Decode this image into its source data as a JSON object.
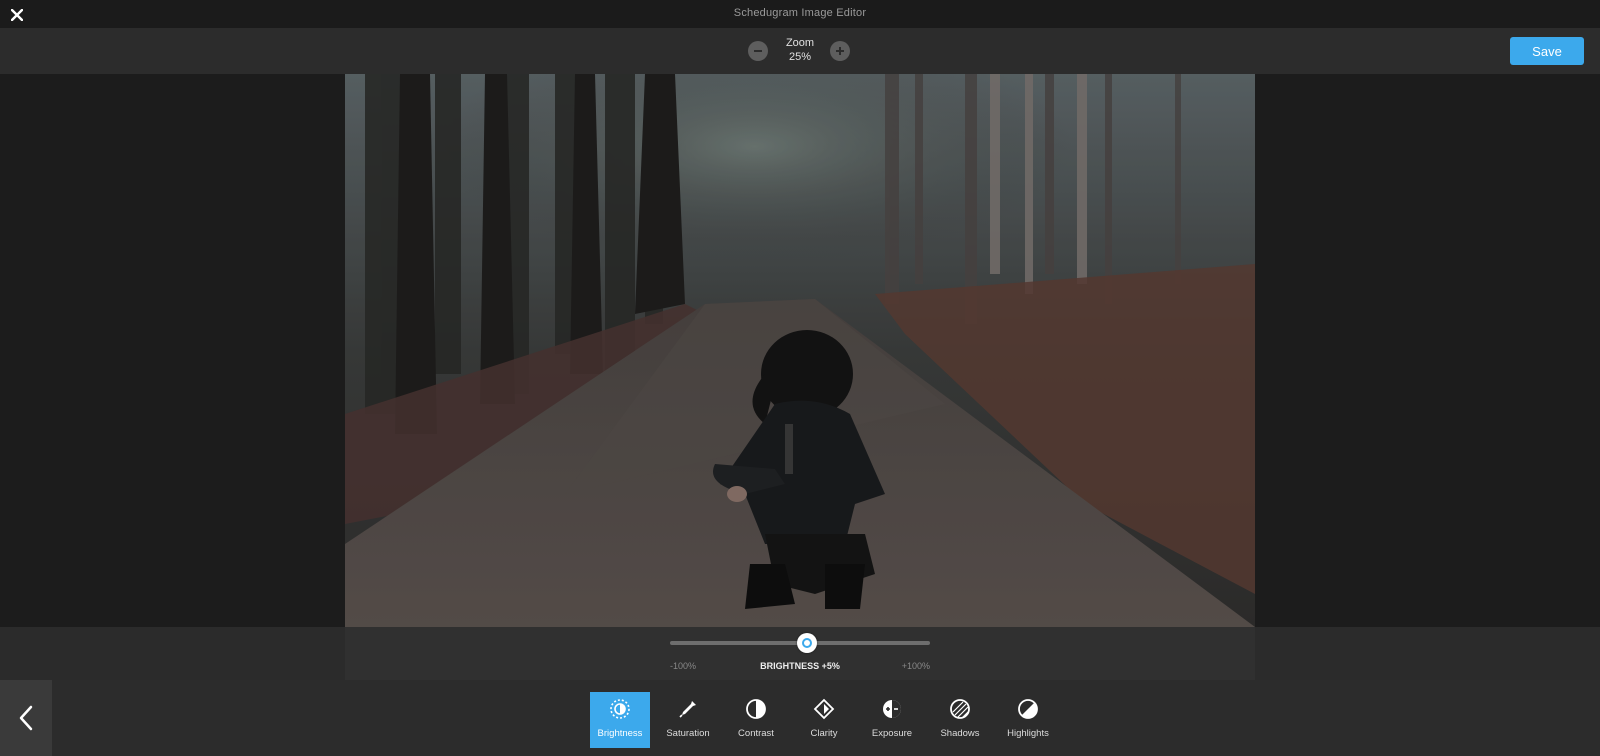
{
  "app": {
    "title": "Schedugram Image Editor"
  },
  "toolbar": {
    "zoom_label": "Zoom",
    "zoom_value": "25%",
    "save_label": "Save"
  },
  "slider": {
    "min_label": "-100%",
    "max_label": "+100%",
    "value_label": "BRIGHTNESS +5%",
    "value_percent": 5,
    "range": [
      -100,
      100
    ]
  },
  "tools": [
    {
      "label": "Brightness",
      "icon": "brightness-icon",
      "active": true
    },
    {
      "label": "Saturation",
      "icon": "eyedropper-icon",
      "active": false
    },
    {
      "label": "Contrast",
      "icon": "contrast-icon",
      "active": false
    },
    {
      "label": "Clarity",
      "icon": "clarity-icon",
      "active": false
    },
    {
      "label": "Exposure",
      "icon": "exposure-icon",
      "active": false
    },
    {
      "label": "Shadows",
      "icon": "shadows-icon",
      "active": false
    },
    {
      "label": "Highlights",
      "icon": "highlights-icon",
      "active": false
    }
  ],
  "colors": {
    "accent": "#3ca9ec",
    "background": "#1c1c1c",
    "bar": "#2c2c2c"
  }
}
